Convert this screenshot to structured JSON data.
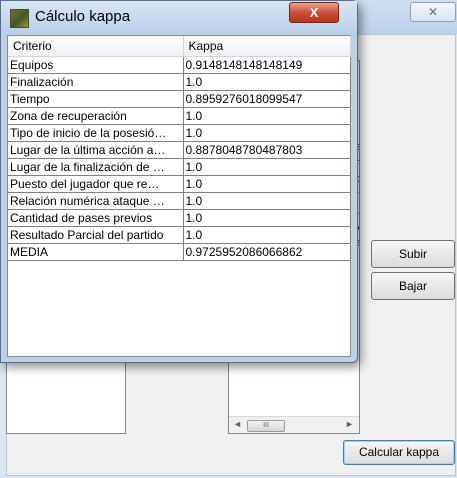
{
  "background_window": {
    "close_glyph": "✕",
    "partial_text": [
      "es",
      "n",
      "dc",
      "r",
      "uc",
      "vic",
      "ar"
    ],
    "scroll_thumb_glyph": "III",
    "scroll_left_glyph": "◄",
    "scroll_right_glyph": "►",
    "buttons": {
      "subir": "Subir",
      "bajar": "Bajar",
      "calcular": "Calcular kappa"
    }
  },
  "dialog": {
    "title": "Cálculo kappa",
    "close_glyph": "X",
    "table": {
      "headers": [
        "Criterio",
        "Kappa"
      ],
      "rows": [
        [
          "Equipos",
          "0.9148148148148149"
        ],
        [
          "Finalización",
          "1.0"
        ],
        [
          "Tiempo",
          "0.8959276018099547"
        ],
        [
          "Zona de recuperación",
          "1.0"
        ],
        [
          "Tipo de inicio de la posesió…",
          "1.0"
        ],
        [
          "Lugar de la última acción a…",
          "0.8878048780487803"
        ],
        [
          "Lugar de la finalización de …",
          "1.0"
        ],
        [
          "Puesto del jugador que re…",
          "1.0"
        ],
        [
          "Relación numérica ataque …",
          "1.0"
        ],
        [
          "Cantidad de pases previos",
          "1.0"
        ],
        [
          "Resultado Parcial del partido",
          "1.0"
        ],
        [
          "MEDIA",
          "0.9725952086066862"
        ]
      ]
    }
  }
}
